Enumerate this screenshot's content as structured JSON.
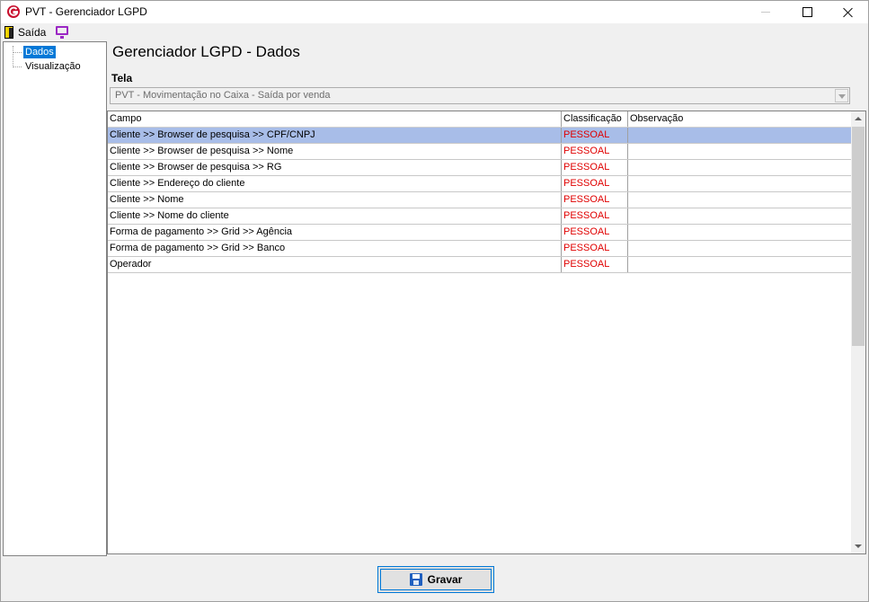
{
  "window": {
    "title": "PVT - Gerenciador LGPD",
    "icon": "app-logo-icon"
  },
  "menubar": {
    "exit_label": "Saída",
    "exit_icon": "door-exit-icon",
    "monitor_icon": "monitor-icon"
  },
  "tree": {
    "items": [
      {
        "label": "Dados",
        "selected": true
      },
      {
        "label": "Visualização",
        "selected": false
      }
    ]
  },
  "main": {
    "heading": "Gerenciador LGPD - Dados",
    "tela_label": "Tela",
    "tela_value": "PVT - Movimentação no Caixa - Saída por venda"
  },
  "grid": {
    "columns": [
      "Campo",
      "Classificação",
      "Observação"
    ],
    "rows": [
      {
        "campo": "Cliente  >> Browser de pesquisa >> CPF/CNPJ",
        "classificacao": "PESSOAL",
        "observacao": ""
      },
      {
        "campo": "Cliente  >> Browser de pesquisa >> Nome",
        "classificacao": "PESSOAL",
        "observacao": ""
      },
      {
        "campo": "Cliente  >> Browser de pesquisa >> RG",
        "classificacao": "PESSOAL",
        "observacao": ""
      },
      {
        "campo": "Cliente >> Endereço do cliente",
        "classificacao": "PESSOAL",
        "observacao": ""
      },
      {
        "campo": "Cliente >> Nome",
        "classificacao": "PESSOAL",
        "observacao": ""
      },
      {
        "campo": "Cliente >> Nome do cliente",
        "classificacao": "PESSOAL",
        "observacao": ""
      },
      {
        "campo": "Forma de pagamento >> Grid >> Agência",
        "classificacao": "PESSOAL",
        "observacao": ""
      },
      {
        "campo": "Forma de pagamento >> Grid >> Banco",
        "classificacao": "PESSOAL",
        "observacao": ""
      },
      {
        "campo": "Operador",
        "classificacao": "PESSOAL",
        "observacao": ""
      }
    ],
    "selected_row": 0
  },
  "footer": {
    "save_label": "Gravar",
    "save_icon": "floppy-disk-icon"
  },
  "colors": {
    "selection": "#a8bde8",
    "classification_text": "#e00000",
    "tree_selection": "#0078d7"
  }
}
